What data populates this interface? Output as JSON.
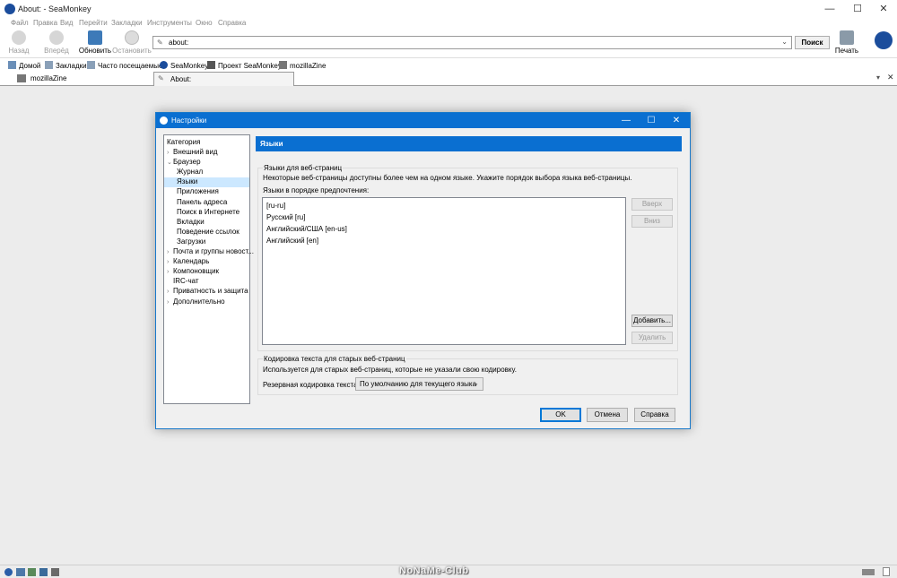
{
  "window": {
    "title": "About: - SeaMonkey",
    "minimize": "—",
    "maximize": "☐",
    "close": "✕"
  },
  "menu": [
    "Файл",
    "Правка",
    "Вид",
    "Перейти",
    "Закладки",
    "Инструменты",
    "Окно",
    "Справка"
  ],
  "toolbar": {
    "back": "Назад",
    "forward": "Вперёд",
    "reload": "Обновить",
    "stop": "Остановить",
    "print": "Печать",
    "search": "Поиск"
  },
  "url": {
    "value": "about:"
  },
  "bookmarks": [
    "Домой",
    "Закладки",
    "Часто посещаемые",
    "SeaMonkey",
    "Проект SeaMonkey",
    "mozillaZine"
  ],
  "tabs": [
    "mozillaZine",
    "About:"
  ],
  "colors": {
    "accent": "#0a6fd1",
    "selection": "#cce8ff",
    "ok_border": "#0078d7"
  },
  "dialog": {
    "title": "Настройки",
    "category_label": "Категория",
    "tree": [
      {
        "label": "Внешний вид",
        "twisty": "›",
        "indent": 0
      },
      {
        "label": "Браузер",
        "twisty": "⌄",
        "indent": 0
      },
      {
        "label": "Журнал",
        "twisty": "",
        "indent": 1
      },
      {
        "label": "Языки",
        "twisty": "",
        "indent": 1,
        "selected": true
      },
      {
        "label": "Приложения",
        "twisty": "",
        "indent": 1
      },
      {
        "label": "Панель адреса",
        "twisty": "",
        "indent": 1
      },
      {
        "label": "Поиск в Интернете",
        "twisty": "",
        "indent": 1
      },
      {
        "label": "Вкладки",
        "twisty": "",
        "indent": 1
      },
      {
        "label": "Поведение ссылок",
        "twisty": "",
        "indent": 1
      },
      {
        "label": "Загрузки",
        "twisty": "",
        "indent": 1
      },
      {
        "label": "Почта и группы новост...",
        "twisty": "›",
        "indent": 0
      },
      {
        "label": "Календарь",
        "twisty": "›",
        "indent": 0
      },
      {
        "label": "Компоновщик",
        "twisty": "›",
        "indent": 0
      },
      {
        "label": "IRC-чат",
        "twisty": "",
        "indent": 0
      },
      {
        "label": "Приватность и защита",
        "twisty": "›",
        "indent": 0
      },
      {
        "label": "Дополнительно",
        "twisty": "›",
        "indent": 0
      }
    ],
    "pane_title": "Языки",
    "web_languages": {
      "group_title": "Языки для веб-страниц",
      "description": "Некоторые веб-страницы доступны более чем на одном языке. Укажите порядок выбора языка веб-страницы.",
      "list_label": "Языки в порядке предпочтения:",
      "languages": [
        "[ru-ru]",
        "Русский  [ru]",
        "Английский/США  [en-us]",
        "Английский  [en]"
      ],
      "up_button": "Вверх",
      "down_button": "Вниз",
      "add_button": "Добавить...",
      "remove_button": "Удалить"
    },
    "encoding": {
      "group_title": "Кодировка текста для старых веб-страниц",
      "description": "Используется для старых веб-страниц, которые не указали свою кодировку.",
      "fallback_label": "Резервная кодировка текста:",
      "fallback_value": "По умолчанию для текущего языка"
    },
    "ok": "OK",
    "cancel": "Отмена",
    "help": "Справка"
  },
  "watermark": "NoNaMe-Club"
}
